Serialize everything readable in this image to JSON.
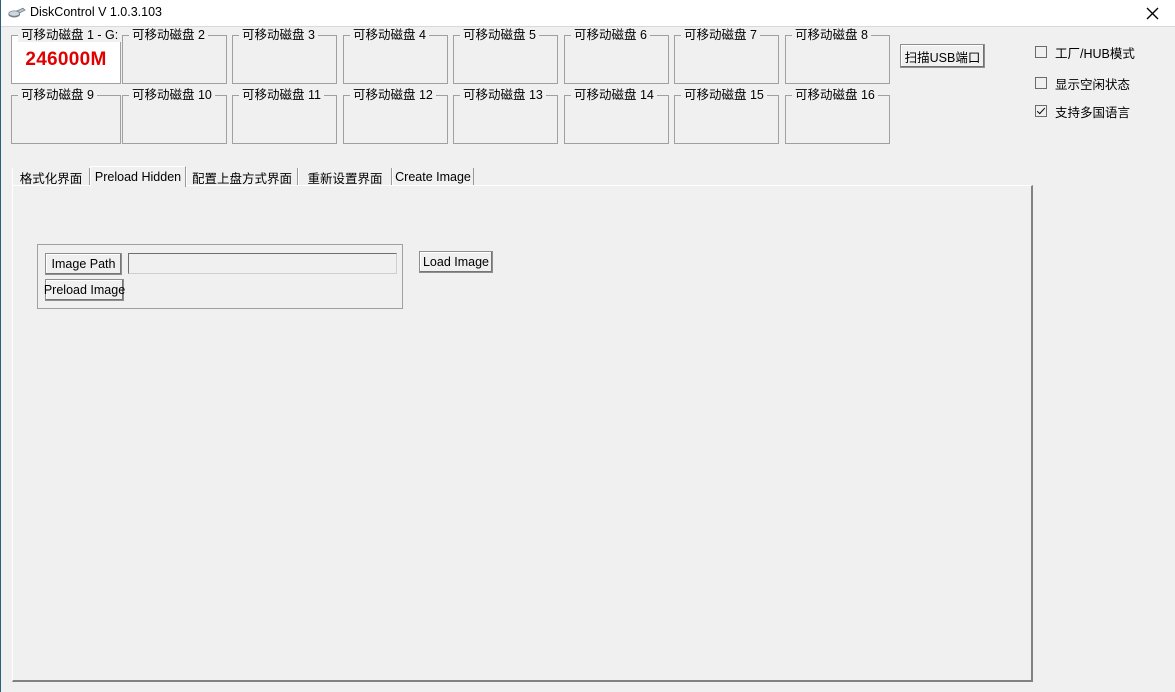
{
  "window": {
    "title": "DiskControl V 1.0.3.103",
    "icon": "usb-drive-icon",
    "close_label": "✕"
  },
  "disks": {
    "row1": [
      {
        "legend": "可移动磁盘 1 - G:",
        "value": "246000M",
        "has_value": true
      },
      {
        "legend": "可移动磁盘 2",
        "value": "",
        "has_value": false
      },
      {
        "legend": "可移动磁盘 3",
        "value": "",
        "has_value": false
      },
      {
        "legend": "可移动磁盘 4",
        "value": "",
        "has_value": false
      },
      {
        "legend": "可移动磁盘 5",
        "value": "",
        "has_value": false
      },
      {
        "legend": "可移动磁盘 6",
        "value": "",
        "has_value": false
      },
      {
        "legend": "可移动磁盘 7",
        "value": "",
        "has_value": false
      },
      {
        "legend": "可移动磁盘 8",
        "value": "",
        "has_value": false
      }
    ],
    "row2": [
      {
        "legend": "可移动磁盘 9",
        "value": "",
        "has_value": false
      },
      {
        "legend": "可移动磁盘 10",
        "value": "",
        "has_value": false
      },
      {
        "legend": "可移动磁盘 11",
        "value": "",
        "has_value": false
      },
      {
        "legend": "可移动磁盘 12",
        "value": "",
        "has_value": false
      },
      {
        "legend": "可移动磁盘 13",
        "value": "",
        "has_value": false
      },
      {
        "legend": "可移动磁盘 14",
        "value": "",
        "has_value": false
      },
      {
        "legend": "可移动磁盘 15",
        "value": "",
        "has_value": false
      },
      {
        "legend": "可移动磁盘 16",
        "value": "",
        "has_value": false
      }
    ],
    "value_color": "#e00000"
  },
  "toolbar": {
    "scan_usb_label": "扫描USB端口"
  },
  "options": [
    {
      "label": "工厂/HUB模式",
      "checked": false
    },
    {
      "label": "显示空闲状态",
      "checked": false
    },
    {
      "label": "支持多国语言",
      "checked": true
    }
  ],
  "tabs": [
    {
      "label": "格式化界面",
      "selected": false
    },
    {
      "label": "Preload Hidden",
      "selected": true
    },
    {
      "label": "配置上盘方式界面",
      "selected": false
    },
    {
      "label": "重新设置界面",
      "selected": false
    },
    {
      "label": "Create Image",
      "selected": false
    }
  ],
  "preload_hidden_page": {
    "image_path_button": "Image Path",
    "preload_image_button": "Preload Image",
    "image_path_value": "",
    "image_path_placeholder": "",
    "load_image_button": "Load Image"
  }
}
